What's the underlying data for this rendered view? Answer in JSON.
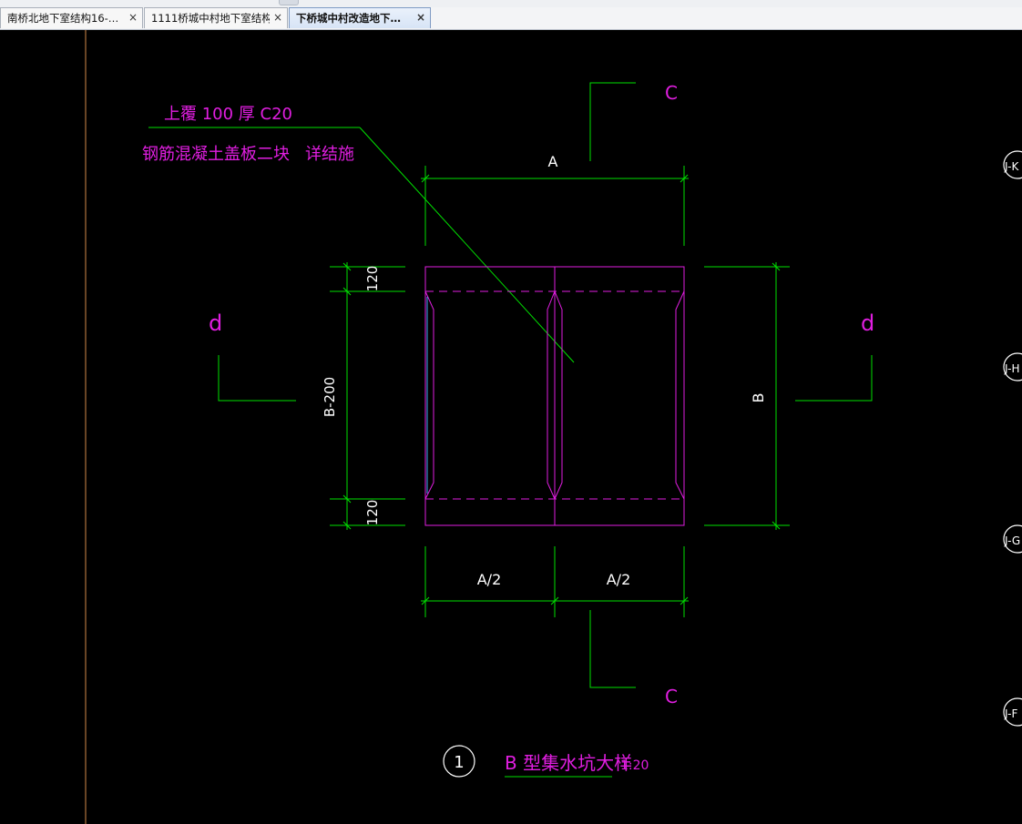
{
  "tabs": [
    {
      "label": "南桥北地下室结构16-…",
      "close": "×"
    },
    {
      "label": "1111桥城中村地下室结构",
      "close": "×"
    },
    {
      "label": "下桥城中村改造地下…",
      "close": "×",
      "active": true
    }
  ],
  "drawing": {
    "note_line1": "上覆  100  厚 C20",
    "note_line2": "钢筋混凝土盖板二块",
    "note_line2b": "详结施",
    "section_c": "C",
    "section_d": "d",
    "dim_a": "A",
    "dim_b": "B",
    "dim_b_minus": "B-200",
    "dim_120": "120",
    "dim_a_half": "A/2",
    "detail_number": "1",
    "detail_title": "B 型集水坑大样",
    "detail_scale": "1:20",
    "grid_bubbles": [
      "J-K",
      "J-H",
      "J-G",
      "J-F"
    ]
  },
  "colors": {
    "background": "#000000",
    "dimension": "#00e000",
    "outline": "#e01ee0",
    "text": "#ffffff"
  }
}
